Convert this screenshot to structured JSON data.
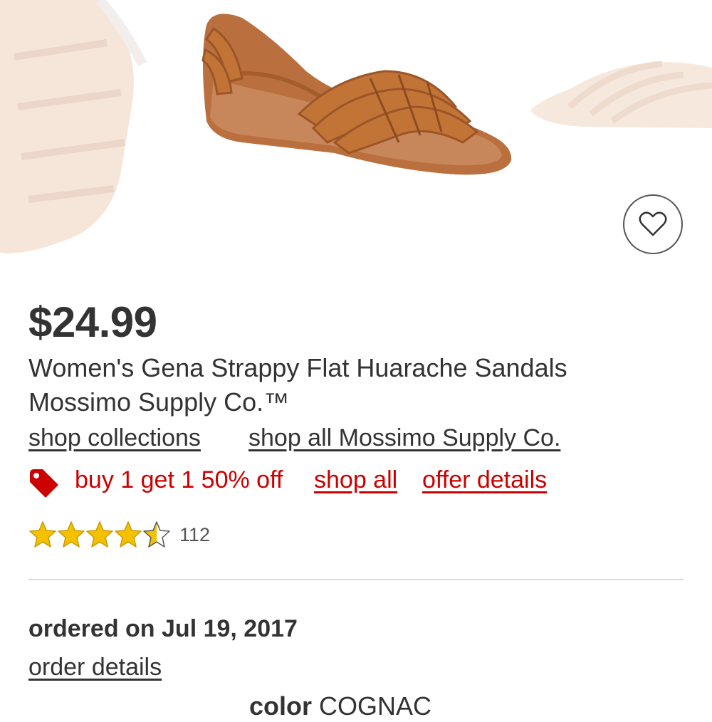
{
  "product": {
    "price": "$24.99",
    "title": "Women's Gena Strappy Flat Huarache Sandals",
    "brand": "Mossimo Supply Co.™"
  },
  "links": {
    "shop_collections": "shop collections",
    "shop_brand": "shop all Mossimo Supply Co."
  },
  "promo": {
    "text": "buy 1 get 1 50% off",
    "shop_all": "shop all",
    "offer_details": "offer details",
    "icon": "price-tag-icon",
    "color": "#cc0000"
  },
  "rating": {
    "stars": 4.5,
    "max_stars": 5,
    "count": "112",
    "star_color": "#f5c000"
  },
  "order": {
    "ordered_on": "ordered on Jul 19, 2017",
    "details_link": "order details"
  },
  "variant": {
    "color_label": "color",
    "color_value": "COGNAC"
  },
  "favorite": {
    "icon": "heart-icon"
  }
}
